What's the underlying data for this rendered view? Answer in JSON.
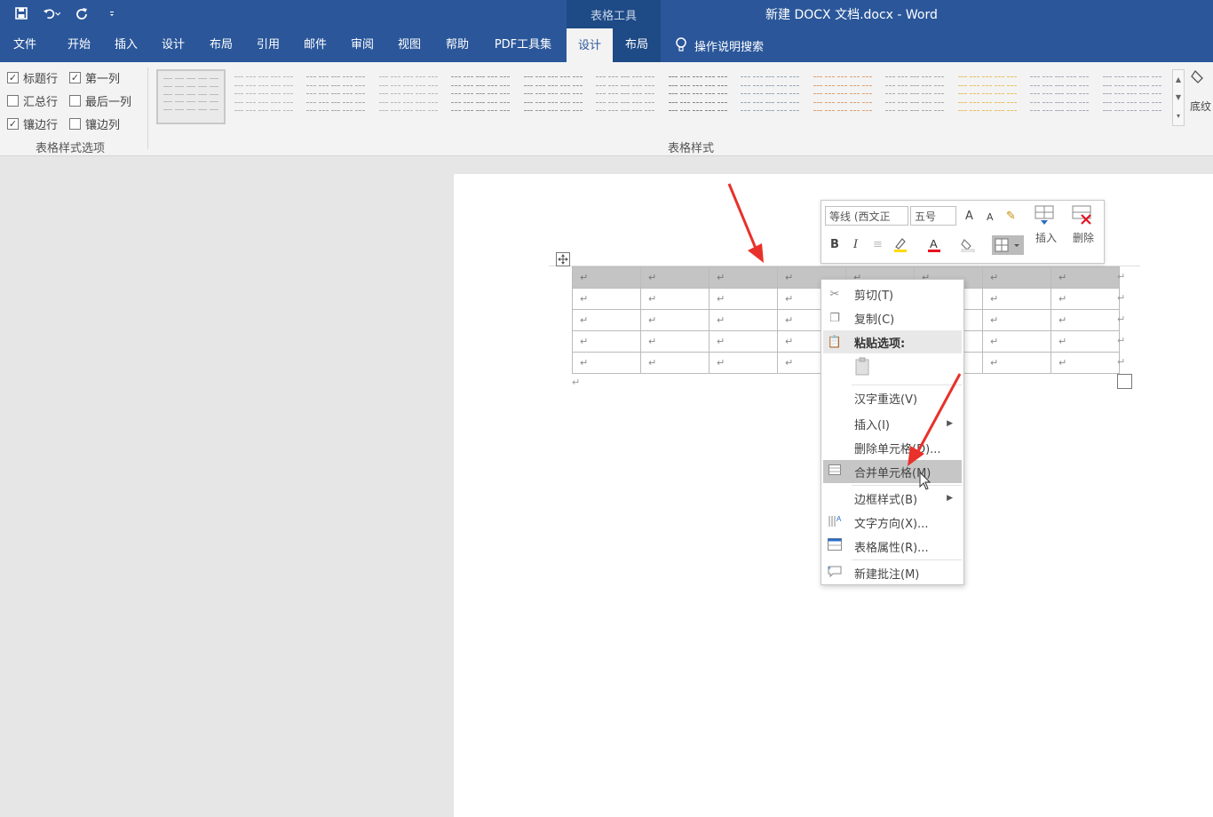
{
  "titlebar": {
    "context_label": "表格工具",
    "document_title": "新建 DOCX 文档.docx  -  Word"
  },
  "tabs": [
    {
      "label": "文件"
    },
    {
      "label": "开始"
    },
    {
      "label": "插入"
    },
    {
      "label": "设计"
    },
    {
      "label": "布局"
    },
    {
      "label": "引用"
    },
    {
      "label": "邮件"
    },
    {
      "label": "审阅"
    },
    {
      "label": "视图"
    },
    {
      "label": "帮助"
    },
    {
      "label": "PDF工具集"
    },
    {
      "label": "设计"
    },
    {
      "label": "布局"
    }
  ],
  "search": {
    "label": "操作说明搜索"
  },
  "table_style_options": {
    "group_label": "表格样式选项",
    "options": [
      {
        "label": "标题行",
        "checked": true
      },
      {
        "label": "第一列",
        "checked": true
      },
      {
        "label": "汇总行",
        "checked": false
      },
      {
        "label": "最后一列",
        "checked": false
      },
      {
        "label": "镶边行",
        "checked": true
      },
      {
        "label": "镶边列",
        "checked": false
      }
    ]
  },
  "table_styles": {
    "group_label": "表格样式",
    "shading_label": "底纹"
  },
  "mini_toolbar": {
    "font_name": "等线 (西文正",
    "font_size": "五号",
    "bold": "B",
    "italic": "I",
    "insert_label": "插入",
    "delete_label": "删除"
  },
  "document": {
    "cell_mark": "↵",
    "rows": 5,
    "cols": 8
  },
  "context_menu": {
    "items": [
      {
        "label": "剪切(T)",
        "icon": "scissors-icon"
      },
      {
        "label": "复制(C)",
        "icon": "copy-icon"
      },
      {
        "label": "粘贴选项:",
        "icon": "paste-icon"
      },
      {
        "label": "汉字重选(V)"
      },
      {
        "label": "插入(I)"
      },
      {
        "label": "删除单元格(D)..."
      },
      {
        "label": "合并单元格(M)",
        "icon": "merge-cells-icon"
      },
      {
        "label": "边框样式(B)"
      },
      {
        "label": "文字方向(X)...",
        "icon": "text-direction-icon"
      },
      {
        "label": "表格属性(R)...",
        "icon": "table-properties-icon"
      },
      {
        "label": "新建批注(M)",
        "icon": "new-comment-icon"
      }
    ]
  },
  "colors": {
    "brand": "#2b579a",
    "context_tab": "#1e4a86",
    "annotation_arrow": "#e8312a"
  }
}
